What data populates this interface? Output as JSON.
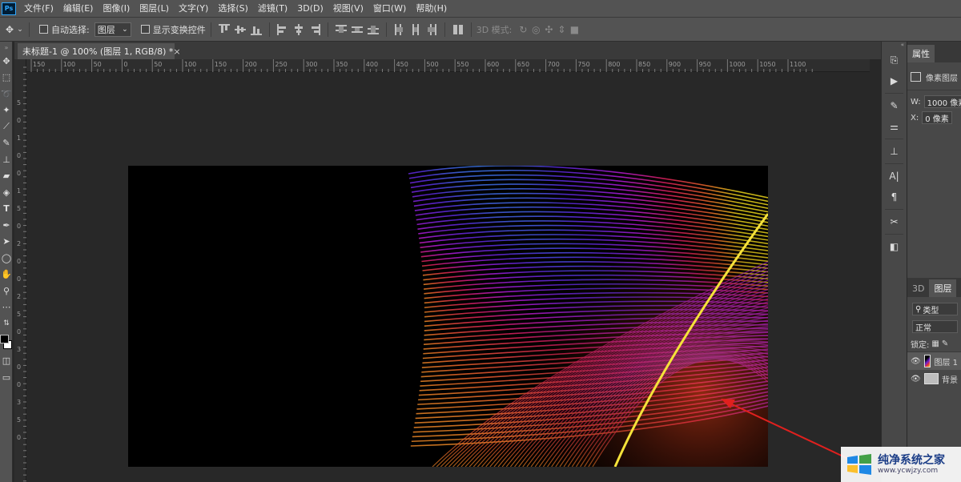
{
  "app": {
    "logo": "Ps"
  },
  "menubar": {
    "items": [
      "文件(F)",
      "编辑(E)",
      "图像(I)",
      "图层(L)",
      "文字(Y)",
      "选择(S)",
      "滤镜(T)",
      "3D(D)",
      "视图(V)",
      "窗口(W)",
      "帮助(H)"
    ]
  },
  "options_bar": {
    "auto_select_label": "自动选择:",
    "auto_select_value": "图层",
    "show_transform_label": "显示变换控件",
    "mode_3d_label": "3D 模式:"
  },
  "document_tab": {
    "title": "未标题-1 @ 100% (图层 1, RGB/8) *",
    "close": "×"
  },
  "ruler": {
    "h_labels": [
      "150",
      "100",
      "50",
      "0",
      "50",
      "100",
      "150",
      "200",
      "250",
      "300",
      "350",
      "400",
      "450",
      "500",
      "550",
      "600",
      "650",
      "700",
      "750",
      "800",
      "850",
      "900",
      "950",
      "1000",
      "1050",
      "1100"
    ],
    "v_labels": [
      "5",
      "0",
      "1",
      "0",
      "0",
      "1",
      "5",
      "0",
      "2",
      "0",
      "0",
      "2",
      "5",
      "0",
      "3",
      "0",
      "0",
      "3",
      "5",
      "0"
    ]
  },
  "properties_panel": {
    "tab_label": "属性",
    "pixel_layer_label": "像素图层",
    "w_label": "W:",
    "w_value": "1000 像素",
    "x_label": "X:",
    "x_value": "0 像素"
  },
  "layers_panel": {
    "tab_3d": "3D",
    "tab_layers": "图层",
    "filter_kind": "类型",
    "blend_mode": "正常",
    "lock_label": "锁定:",
    "layer1_name": "图层 1",
    "background_name": "背景"
  },
  "colors": {
    "accent_arrow": "#e0201e",
    "panel_bg": "#535353",
    "canvas_bg": "#282828"
  },
  "watermark": {
    "title": "纯净系统之家",
    "url": "www.ycwjzy.com"
  }
}
